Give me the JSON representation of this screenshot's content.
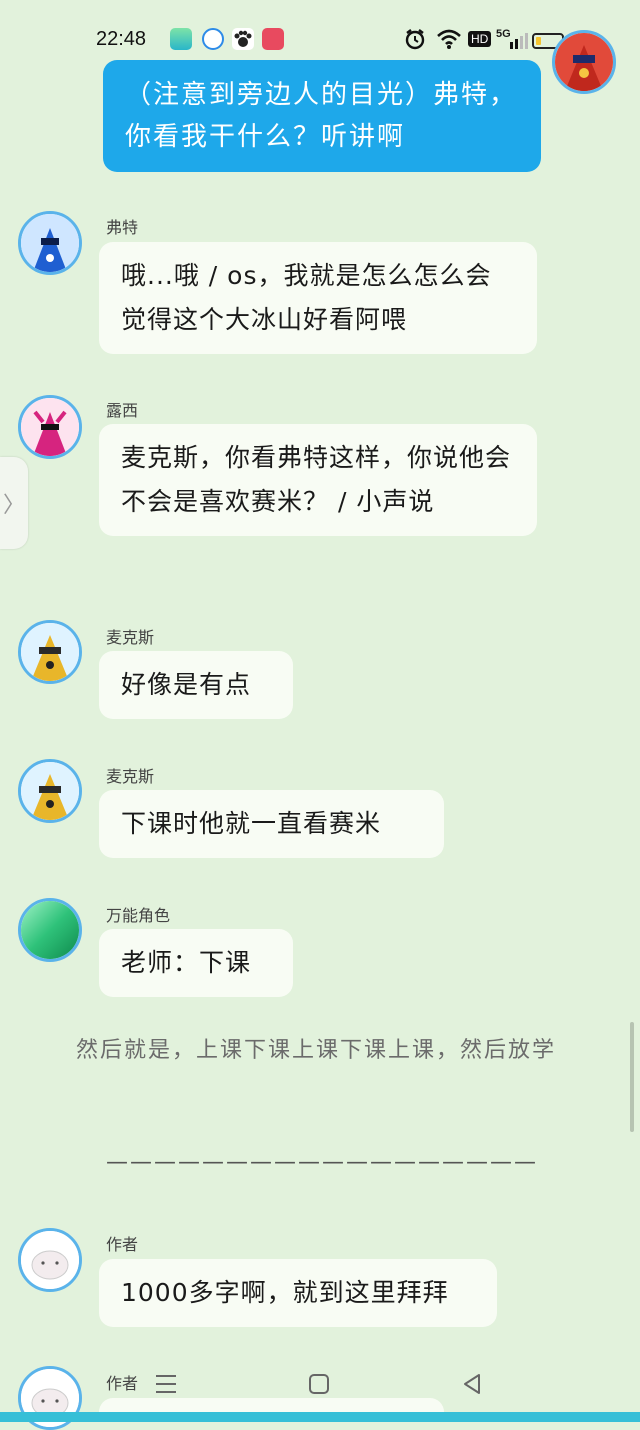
{
  "status_bar": {
    "time": "22:48",
    "network_label": "HD",
    "signal_label": "5G",
    "battery_level": 0.2,
    "icons": [
      "app-green-icon",
      "browser-icon",
      "paw-app-icon",
      "game-app-icon",
      "alarm-icon",
      "wifi-icon",
      "signal-icon",
      "battery-icon"
    ]
  },
  "self_message": {
    "text": "（注意到旁边人的目光）弗特，你看我干什么？听讲啊"
  },
  "messages": [
    {
      "name": "弗特",
      "text": "哦...哦 / os，我就是怎么怎么会觉得这个大冰山好看阿喂",
      "avatar_color": "#1f5fd1"
    },
    {
      "name": "露西",
      "text": "麦克斯，你看弗特这样，你说他会不会是喜欢赛米？ / 小声说",
      "avatar_color": "#d6247f"
    },
    {
      "name": "麦克斯",
      "text": "好像是有点",
      "avatar_color": "#e8b62a"
    },
    {
      "name": "麦克斯",
      "text": "下课时他就一直看赛米",
      "avatar_color": "#e8b62a"
    },
    {
      "name": "万能角色",
      "text": "老师：下课",
      "avatar_color": "#2fc27a"
    }
  ],
  "narration": "然后就是，上课下课上课下课上课，然后放学",
  "divider": "——————————————————",
  "author_messages": [
    {
      "name": "作者",
      "text": "1000多字啊，就到这里拜拜"
    },
    {
      "name": "作者",
      "text": ""
    }
  ],
  "side_handle_glyph": "〉",
  "nav": {
    "menu": "menu-icon",
    "home": "home-icon",
    "back": "back-icon"
  }
}
